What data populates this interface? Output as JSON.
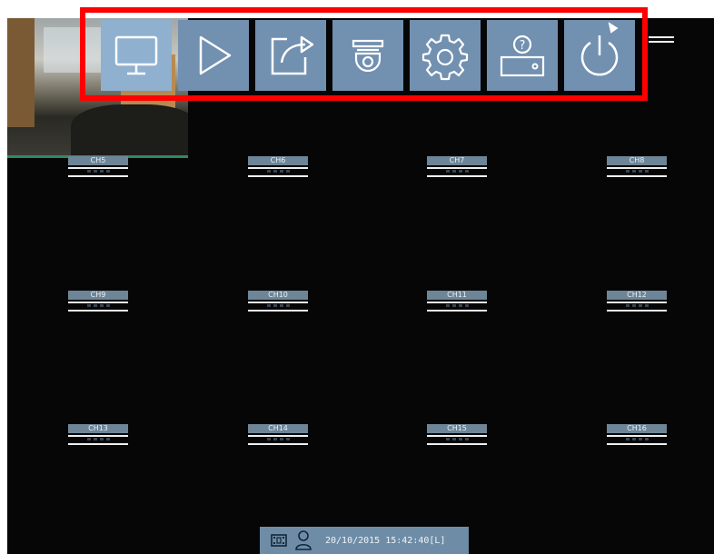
{
  "menu": {
    "items": [
      {
        "name": "Live View",
        "icon": "monitor-icon"
      },
      {
        "name": "Playback",
        "icon": "play-icon"
      },
      {
        "name": "Export",
        "icon": "export-icon"
      },
      {
        "name": "PTZ",
        "icon": "dome-camera-icon"
      },
      {
        "name": "Settings",
        "icon": "gear-icon"
      },
      {
        "name": "Help",
        "icon": "hdd-help-icon"
      },
      {
        "name": "Shutdown",
        "icon": "power-icon"
      }
    ]
  },
  "channels": [
    "CH5",
    "CH6",
    "CH7",
    "CH8",
    "CH9",
    "CH10",
    "CH11",
    "CH12",
    "CH13",
    "CH14",
    "CH15",
    "CH16"
  ],
  "status": {
    "datetime": "20/10/2015 15:42:40[L]",
    "icons": [
      "film-icon",
      "user-icon"
    ]
  },
  "colors": {
    "menu_button": "#7290b0",
    "highlight_border": "#ff0000",
    "status_bar": "#6e8ca6",
    "channel_label": "#6d8597"
  }
}
